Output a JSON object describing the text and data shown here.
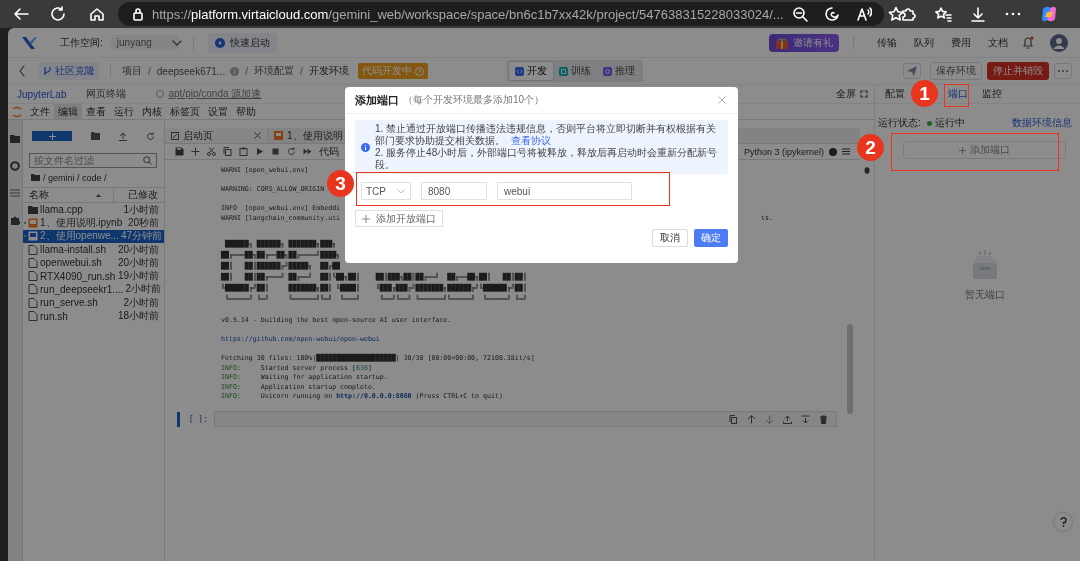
{
  "browser": {
    "url": "https://**platform.virtaicloud.com**/gemini_web/workspace/space/bn6c1b7xx42k/project/547638315228033024/..."
  },
  "app_header": {
    "workspace_label": "工作空间:",
    "workspace": "junyang",
    "quick_start": "快速启动",
    "invite": "邀请有礼",
    "nav": [
      "传输",
      "队列",
      "费用",
      "文档"
    ]
  },
  "breadcrumb": {
    "clone_tag": "社区克隆",
    "items": [
      "项目",
      "deepseek671...",
      "环境配置",
      "开发环境"
    ],
    "separator": "/",
    "status": "代码开发中",
    "modes": [
      {
        "label": "开发",
        "selected": true,
        "kind": "develop"
      },
      {
        "label": "训练",
        "selected": false,
        "kind": "train"
      },
      {
        "label": "推理",
        "selected": false,
        "kind": "infer"
      }
    ],
    "save": "保存环境",
    "stop": "停止并销毁"
  },
  "env_tabs": [
    {
      "label": "JupyterLab",
      "selected": true
    },
    {
      "label": "网页终端",
      "selected": false
    }
  ],
  "accel_link": "apt/pip/conda 源加速",
  "fullscreen": "全屏",
  "side_tabs": [
    {
      "label": "配置",
      "selected": false
    },
    {
      "label": "端口",
      "selected": true
    },
    {
      "label": "监控",
      "selected": false
    }
  ],
  "jupyter": {
    "menu": [
      {
        "label": "文件",
        "selected": false
      },
      {
        "label": "编辑",
        "selected": true
      },
      {
        "label": "查看",
        "selected": false
      },
      {
        "label": "运行",
        "selected": false
      },
      {
        "label": "内核",
        "selected": false
      },
      {
        "label": "标签页",
        "selected": false
      },
      {
        "label": "设置",
        "selected": false
      },
      {
        "label": "帮助",
        "selected": false
      }
    ],
    "file_browser": {
      "filter_placeholder": "按文件名过滤",
      "path": "/ gemini / code /",
      "columns": [
        "名称",
        "已修改"
      ],
      "files": [
        {
          "name": "llama.cpp",
          "modified": "1小时前",
          "kind": "folder",
          "selected": false,
          "running": false
        },
        {
          "name": "1、使用说明.ipynb",
          "modified": "20秒前",
          "kind": "notebook",
          "selected": false,
          "running": true
        },
        {
          "name": "2、使用openwe...",
          "modified": "47分钟前",
          "kind": "notebook",
          "selected": true,
          "running": true
        },
        {
          "name": "llama-install.sh",
          "modified": "20小时前",
          "kind": "file",
          "selected": false,
          "running": false
        },
        {
          "name": "openwebui.sh",
          "modified": "20小时前",
          "kind": "file",
          "selected": false,
          "running": false
        },
        {
          "name": "RTX4090_run.sh",
          "modified": "19小时前",
          "kind": "file",
          "selected": false,
          "running": false
        },
        {
          "name": "run_deepseekr1....",
          "modified": "2小时前",
          "kind": "file",
          "selected": false,
          "running": false
        },
        {
          "name": "run_serve.sh",
          "modified": "2小时前",
          "kind": "file",
          "selected": false,
          "running": false
        },
        {
          "name": "run.sh",
          "modified": "18小时前",
          "kind": "file",
          "selected": false,
          "running": false
        }
      ]
    },
    "notebook": {
      "tabs": [
        {
          "label": "启动页",
          "kind": "launcher"
        },
        {
          "label": "1、使用说明",
          "kind": "notebook"
        }
      ],
      "cell_type": "代码",
      "kernel": "Python 3 (ipykernel)",
      "output": [
        {
          "kind": "text",
          "lines": [
            {
              "segments": [
                {
                  "text": "WARNI [open_webui.env]"
                }
              ]
            }
          ]
        },
        {
          "kind": "text",
          "lines": [
            {
              "segments": [
                {
                  "text": "WARNING: CORS_ALLOW_ORIGIN"
                }
              ]
            }
          ]
        },
        {
          "kind": "text",
          "lines": [
            {
              "segments": [
                {
                  "text": "INFO  [open_webui.env] Embeddi"
                }
              ]
            },
            {
              "segments": [
                {
                  "text": "WARNI [langchain_community.uti"
                }
              ],
              "tail": "ts."
            }
          ]
        },
        {
          "kind": "art",
          "lines": [
            " ██████╗ ██████╗ ███████╗███╗",
            "██╔═══██╗██╔══██╗██╔════╝████╗",
            "██║   ██║██████╔╝█████╗  ██╔██",
            "██║   ██║██╔═══╝ ██╔══╝  ██║╚██╗██║    ██║███╗██║██╔══╝  ██╔══██╗██║   ██║██║",
            "╚██████╔╝██║     ███████╗██║ ╚████║    ╚███╔███╔╝███████╗██████╔╝╚██████╔╝██║",
            " ╚═════╝ ╚═╝     ╚══════╝╚═╝  ╚═══╝     ╚══╝╚══╝ ╚══════╝╚═════╝  ╚═════╝ ╚═╝"
          ]
        },
        {
          "kind": "text",
          "lines": [
            {
              "segments": [
                {
                  "text": "v0.5.14 - building the best open-source AI user interface."
                }
              ]
            }
          ]
        },
        {
          "kind": "link",
          "lines": [
            {
              "segments": [
                {
                  "text": "https://github.com/open-webui/open-webui"
                }
              ]
            }
          ]
        },
        {
          "kind": "text",
          "lines": [
            {
              "segments": [
                {
                  "text": "Fetching 30 files: 100%|"
                },
                {
                  "text": "████████████████████",
                  "kind": "bar"
                },
                {
                  "text": "| 30/30 [00:00<00:00, 72108.38it/s]"
                }
              ]
            },
            {
              "segments": [
                {
                  "text": "INFO:",
                  "kind": "green"
                },
                {
                  "text": "     Started server process ["
                },
                {
                  "text": "636",
                  "kind": "teal"
                },
                {
                  "text": "]"
                }
              ]
            },
            {
              "segments": [
                {
                  "text": "INFO:",
                  "kind": "green"
                },
                {
                  "text": "     Waiting for application startup."
                }
              ]
            },
            {
              "segments": [
                {
                  "text": "INFO:",
                  "kind": "green"
                },
                {
                  "text": "     Application startup complete."
                }
              ]
            },
            {
              "segments": [
                {
                  "text": "INFO:",
                  "kind": "green"
                },
                {
                  "text": "     Uvicorn running on "
                },
                {
                  "text": "http://0.0.0.0:8080",
                  "kind": "link"
                },
                {
                  "text": " (Press CTRL+C to quit)"
                }
              ]
            }
          ]
        }
      ],
      "prompt": "[ ]:"
    }
  },
  "side_panel": {
    "status_label": "运行状态:",
    "status": "运行中",
    "info_link": "数据环境信息",
    "add_port": "添加端口",
    "empty": "暂无端口"
  },
  "modal": {
    "title": "添加端口",
    "subtitle": "（每个开发环境最多添加10个）",
    "notice": [
      "1. 禁止通过开放端口传播违法违规信息，否则平台将立即切断并有权根据有关部门要求协助提交相关数据。",
      "2. 服务停止48小时后，外部端口号将被释放，释放后再启动时会重新分配新号段。"
    ],
    "notice_link": "查看协议",
    "ports": [
      {
        "protocol": "TCP",
        "port": "8080",
        "name": "webui"
      }
    ],
    "add_button": "添加开放端口",
    "cancel": "取消",
    "confirm": "确定"
  },
  "annotations": [
    {
      "label": "1"
    },
    {
      "label": "2"
    },
    {
      "label": "3"
    }
  ]
}
